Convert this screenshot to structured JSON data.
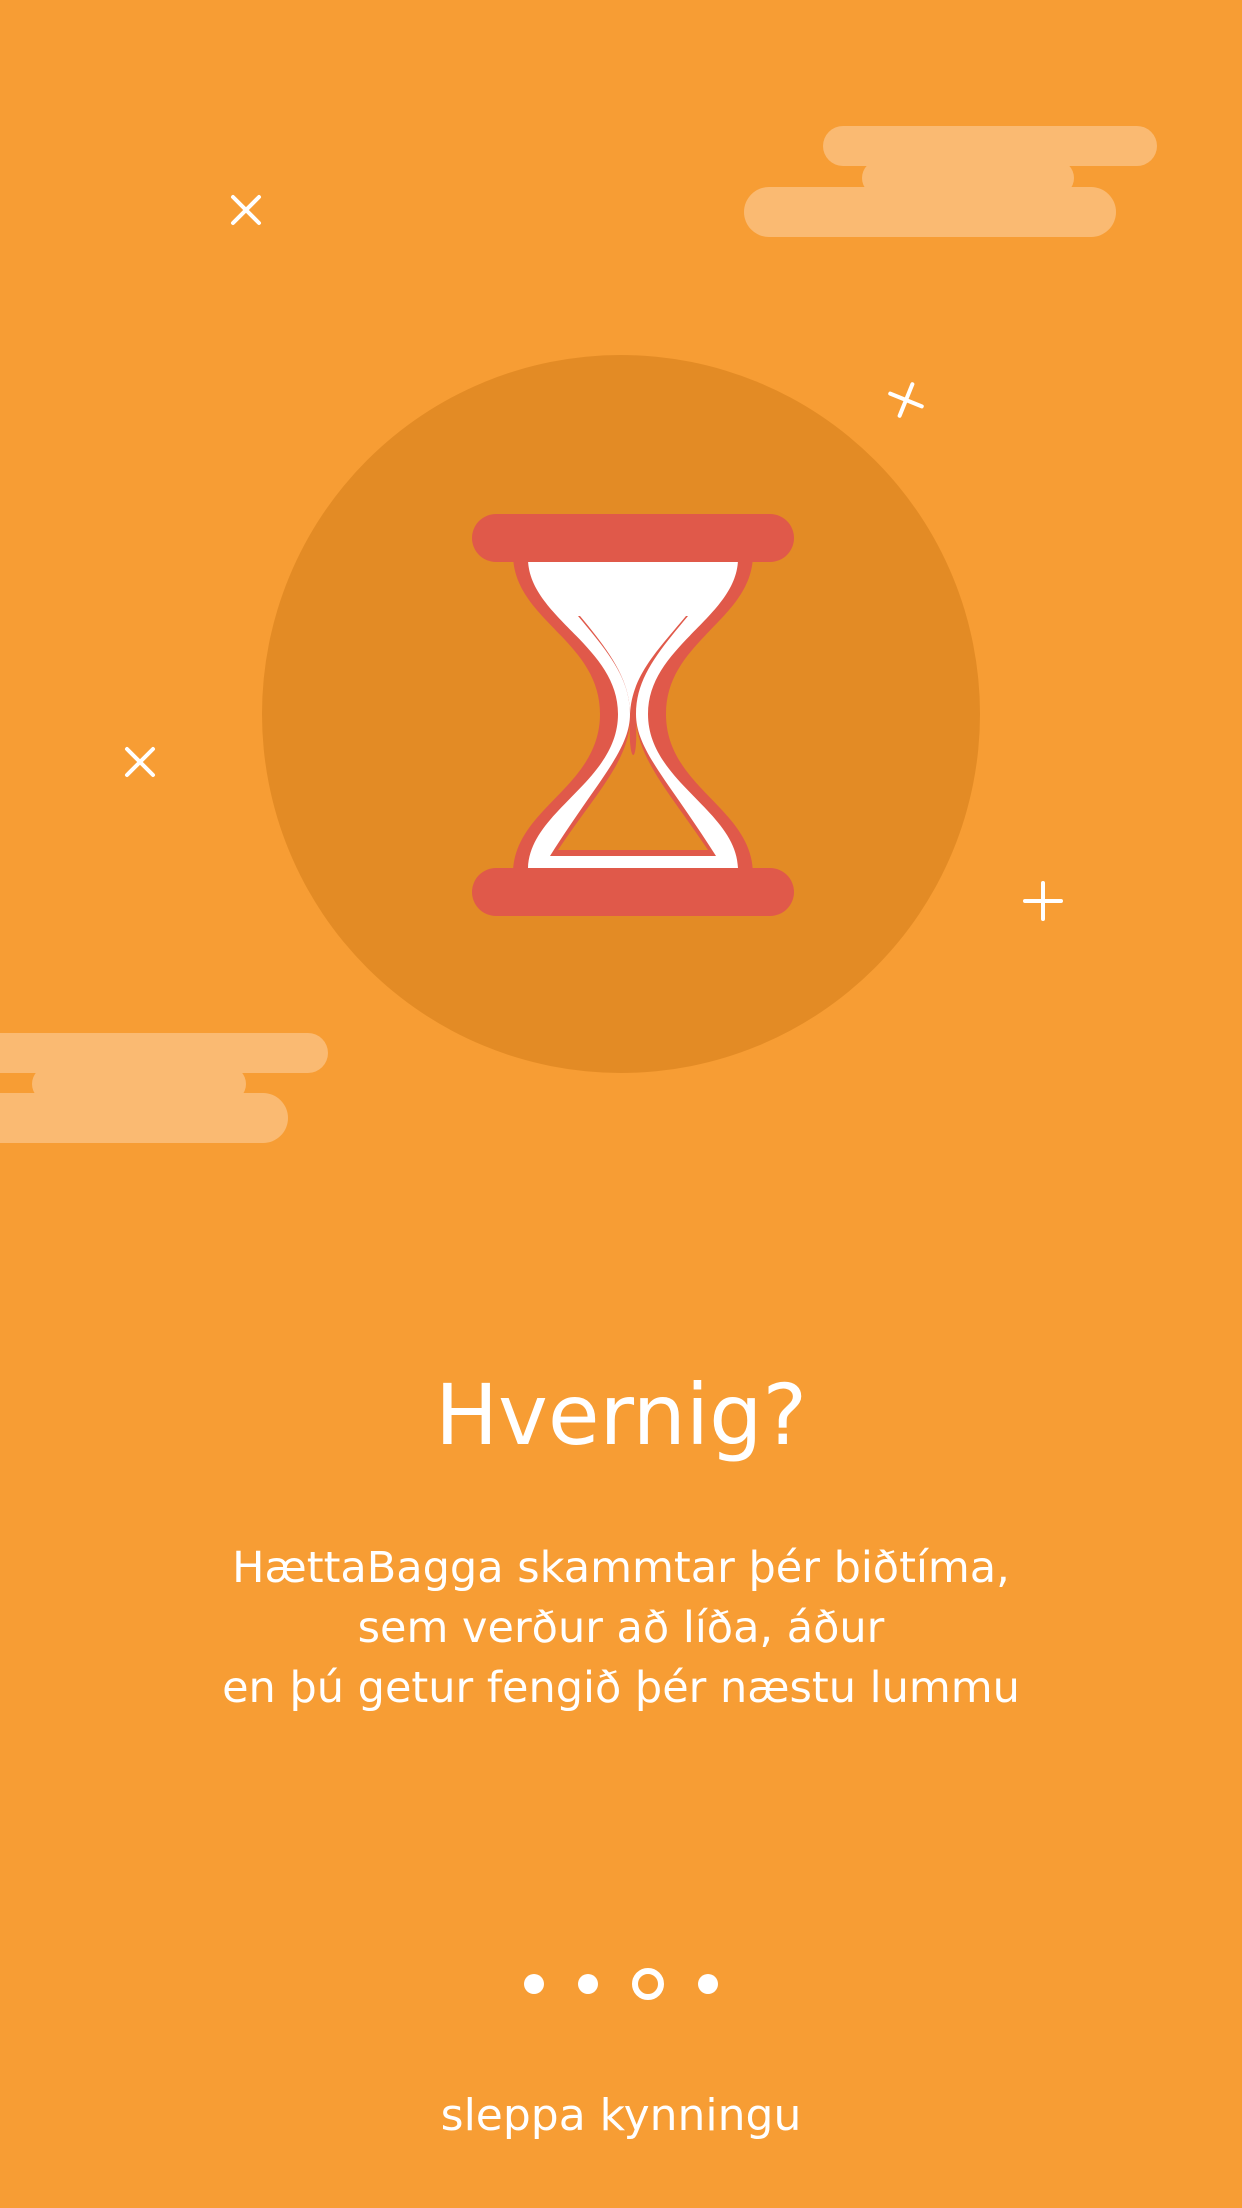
{
  "onboarding": {
    "title": "Hvernig?",
    "description_lines": [
      "HættaBagga skammtar þér biðtíma,",
      "sem verður að líða, áður",
      "en þú getur fengið þér næstu lummu"
    ],
    "illustration_icon": "hourglass-icon",
    "page_indicator": {
      "total": 4,
      "current": 3
    },
    "skip_label": "sleppa kynningu"
  },
  "colors": {
    "background": "#F79D34",
    "circle": "#E38B25",
    "cloud": "#FABA72",
    "hourglass_frame": "#E0594A",
    "text": "#FFFFFF"
  }
}
